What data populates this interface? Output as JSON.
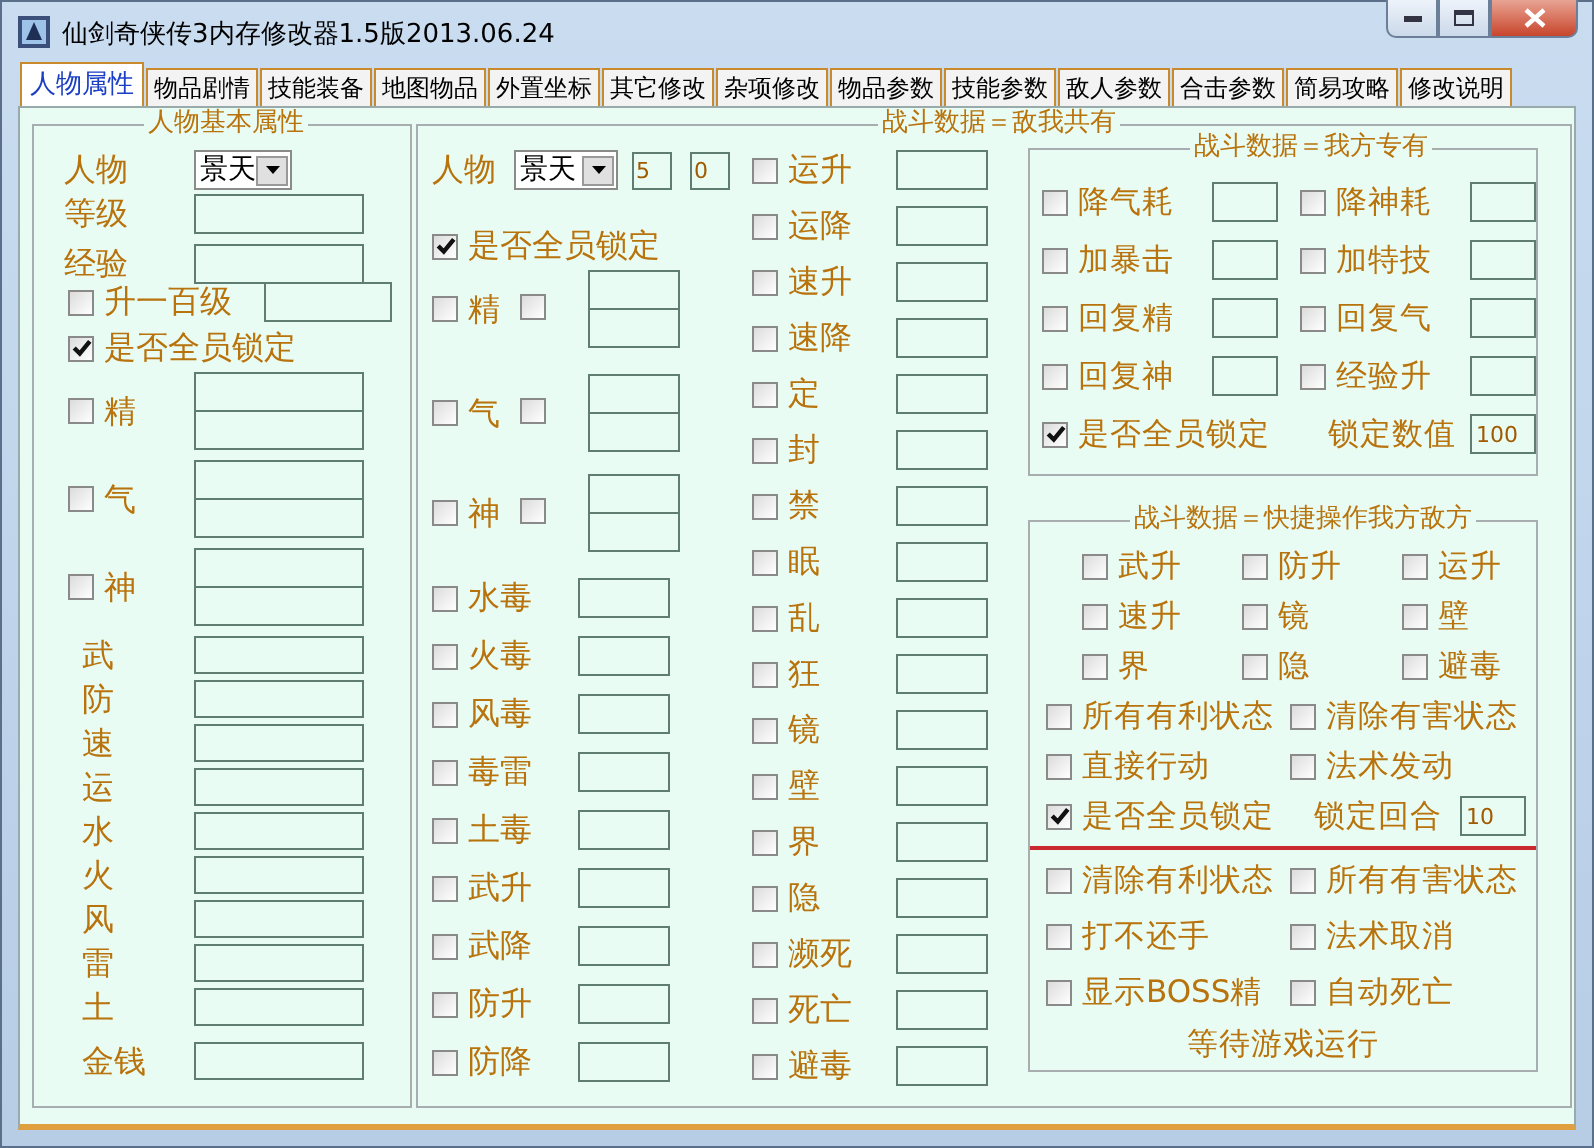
{
  "window": {
    "title": "仙剑奇侠传3内存修改器1.5版2013.06.24"
  },
  "tabs": [
    {
      "label": "人物属性",
      "selected": true
    },
    {
      "label": "物品剧情",
      "selected": false
    },
    {
      "label": "技能装备",
      "selected": false
    },
    {
      "label": "地图物品",
      "selected": false
    },
    {
      "label": "外置坐标",
      "selected": false
    },
    {
      "label": "其它修改",
      "selected": false
    },
    {
      "label": "杂项修改",
      "selected": false
    },
    {
      "label": "物品参数",
      "selected": false
    },
    {
      "label": "技能参数",
      "selected": false
    },
    {
      "label": "敌人参数",
      "selected": false
    },
    {
      "label": "合击参数",
      "selected": false
    },
    {
      "label": "简易攻略",
      "selected": false
    },
    {
      "label": "修改说明",
      "selected": false
    }
  ],
  "basic_attributes": {
    "title": "人物基本属性",
    "character": {
      "label": "人物",
      "value": "景天"
    },
    "level": {
      "label": "等级"
    },
    "experience": {
      "label": "经验"
    },
    "level_up": {
      "label": "升一百级",
      "checked": false
    },
    "lock_all": {
      "label": "是否全员锁定",
      "checked": true
    },
    "dual_stats": [
      {
        "label": "精",
        "checked": false
      },
      {
        "label": "气",
        "checked": false
      },
      {
        "label": "神",
        "checked": false
      }
    ],
    "stats": [
      {
        "label": "武"
      },
      {
        "label": "防"
      },
      {
        "label": "速"
      },
      {
        "label": "运"
      },
      {
        "label": "水"
      },
      {
        "label": "火"
      },
      {
        "label": "风"
      },
      {
        "label": "雷"
      },
      {
        "label": "土"
      }
    ],
    "money": {
      "label": "金钱"
    }
  },
  "battle_shared": {
    "title": "战斗数据＝敌我共有",
    "character": {
      "label": "人物",
      "value": "景天",
      "field_1": "5",
      "field_2": "0"
    },
    "lock_all": {
      "label": "是否全员锁定",
      "checked": true
    },
    "dual_stats": [
      {
        "label": "精",
        "checked": false,
        "checked_2": false
      },
      {
        "label": "气",
        "checked": false,
        "checked_2": false
      },
      {
        "label": "神",
        "checked": false,
        "checked_2": false
      }
    ],
    "statuses": [
      {
        "label": "水毒",
        "checked": false
      },
      {
        "label": "火毒",
        "checked": false
      },
      {
        "label": "风毒",
        "checked": false
      },
      {
        "label": "毒雷",
        "checked": false
      },
      {
        "label": "土毒",
        "checked": false
      },
      {
        "label": "武升",
        "checked": false
      },
      {
        "label": "武降",
        "checked": false
      },
      {
        "label": "防升",
        "checked": false
      },
      {
        "label": "防降",
        "checked": false
      }
    ],
    "statuses_2": [
      {
        "label": "运升",
        "checked": false
      },
      {
        "label": "运降",
        "checked": false
      },
      {
        "label": "速升",
        "checked": false
      },
      {
        "label": "速降",
        "checked": false
      },
      {
        "label": "定",
        "checked": false
      },
      {
        "label": "封",
        "checked": false
      },
      {
        "label": "禁",
        "checked": false
      },
      {
        "label": "眠",
        "checked": false
      },
      {
        "label": "乱",
        "checked": false
      },
      {
        "label": "狂",
        "checked": false
      },
      {
        "label": "镜",
        "checked": false
      },
      {
        "label": "壁",
        "checked": false
      },
      {
        "label": "界",
        "checked": false
      },
      {
        "label": "隐",
        "checked": false
      },
      {
        "label": "濒死",
        "checked": false
      },
      {
        "label": "死亡",
        "checked": false
      },
      {
        "label": "避毒",
        "checked": false
      }
    ]
  },
  "battle_ours": {
    "title": "战斗数据＝我方专有",
    "items": [
      {
        "label": "降气耗",
        "checked": false
      },
      {
        "label": "降神耗",
        "checked": false
      },
      {
        "label": "加暴击",
        "checked": false
      },
      {
        "label": "加特技",
        "checked": false
      },
      {
        "label": "回复精",
        "checked": false
      },
      {
        "label": "回复气",
        "checked": false
      },
      {
        "label": "回复神",
        "checked": false
      },
      {
        "label": "经验升",
        "checked": false
      }
    ],
    "lock_all": {
      "label": "是否全员锁定",
      "checked": true
    },
    "lock_value": {
      "label": "锁定数值",
      "value": "100"
    }
  },
  "quick_ops": {
    "title": "战斗数据＝快捷操作我方敌方",
    "grid": [
      {
        "label": "武升",
        "checked": false
      },
      {
        "label": "防升",
        "checked": false
      },
      {
        "label": "运升",
        "checked": false
      },
      {
        "label": "速升",
        "checked": false
      },
      {
        "label": "镜",
        "checked": false
      },
      {
        "label": "壁",
        "checked": false
      },
      {
        "label": "界",
        "checked": false
      },
      {
        "label": "隐",
        "checked": false
      },
      {
        "label": "避毒",
        "checked": false
      }
    ],
    "items": [
      {
        "label": "所有有利状态",
        "checked": false
      },
      {
        "label": "清除有害状态",
        "checked": false
      },
      {
        "label": "直接行动",
        "checked": false
      },
      {
        "label": "法术发动",
        "checked": false
      }
    ],
    "lock_all": {
      "label": "是否全员锁定",
      "checked": true
    },
    "lock_rounds": {
      "label": "锁定回合",
      "value": "10"
    },
    "items_2": [
      {
        "label": "清除有利状态",
        "checked": false
      },
      {
        "label": "所有有害状态",
        "checked": false
      },
      {
        "label": "打不还手",
        "checked": false
      },
      {
        "label": "法术取消",
        "checked": false
      },
      {
        "label": "显示BOSS精",
        "checked": false
      },
      {
        "label": "自动死亡",
        "checked": false
      }
    ],
    "status": "等待游戏运行"
  }
}
